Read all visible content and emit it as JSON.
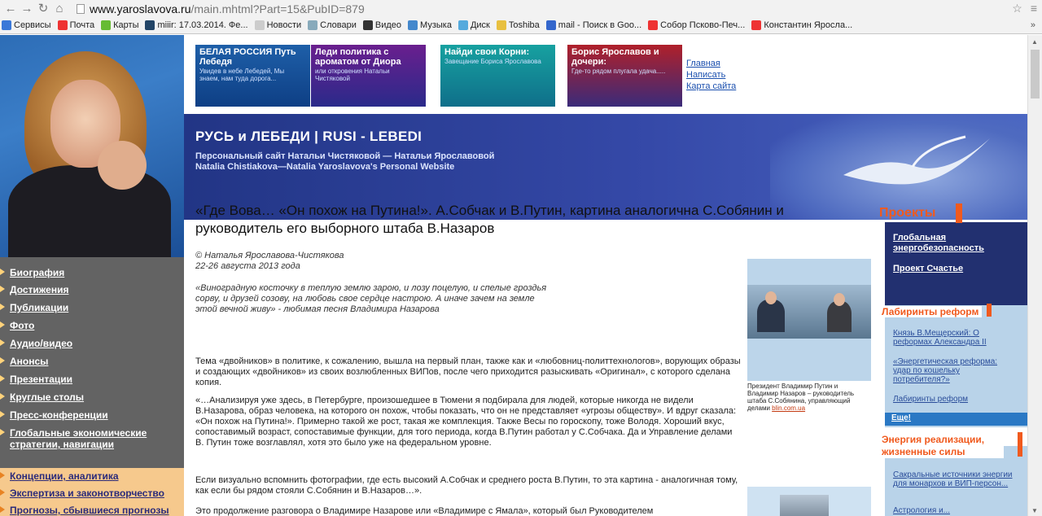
{
  "browser": {
    "url_host": "www.yaroslavova.ru",
    "url_path": "/main.mhtml?Part=15&PubID=879",
    "bookmarks": [
      "Сервисы",
      "Почта",
      "Карты",
      "miiir: 17.03.2014. Фе...",
      "Новости",
      "Словари",
      "Видео",
      "Музыка",
      "Диск",
      "Toshiba",
      "mail - Поиск в Goo...",
      "Собор Псково-Печ...",
      "Константин Яросла..."
    ],
    "more": "»"
  },
  "banners": [
    {
      "title": "БЕЛАЯ РОССИЯ Путь Лебедя",
      "sub": "Увидев в небе Лебедей, Мы знаем, нам туда дорога..."
    },
    {
      "title": "Леди политика с ароматом от Диора",
      "sub": "или откровения Натальи Чистяковой"
    },
    {
      "title": "Найди свои Корни:",
      "sub": "Завещание Бориса Ярославова"
    },
    {
      "title": "Борис Ярославов и дочери:",
      "sub": "Где-то рядом плугала удача....."
    }
  ],
  "toplinks": [
    "Главная",
    "Написать",
    "Карта сайта"
  ],
  "hero": {
    "title": "РУСЬ и ЛЕБЕДИ | RUSI - LEBEDI",
    "sub1": "Персональный сайт Натальи Чистяковой — Натальи Ярославовой",
    "sub2": "Natalia Chistiakova—Natalia Yaroslavova's  Personal Website"
  },
  "leftnav": [
    "Биография",
    "Достижения",
    "Публикации",
    "Фото",
    "Аудио/видео",
    "Анонсы",
    "Презентации",
    "Круглые столы",
    "Пресс-конференции",
    "Глобальные экономические стратегии, навигации",
    "Концепции, аналитика",
    "Экспертиза и законотворчество",
    "Прогнозы, сбывшиеся прогнозы"
  ],
  "article": {
    "title": "«Где Вова… «Он похож на Путина!». А.Собчак и В.Путин, картина аналогична С.Собянин и руководитель его выборного штаба В.Назаров",
    "author": "© Наталья Ярославова-Чистякова",
    "date": "22-26 августа 2013 года",
    "poem": "«Виноградную косточку в теплую землю зарою, и лозу поцелую, и спелые гроздья сорву, и друзей созову, на любовь свое сердце настрою. А иначе зачем на земле этой вечной живу» - любимая песня Владимира Назарова",
    "p1": "Тема «двойников» в политике, к сожалению, вышла на первый план, также как и «любовниц-политтехнологов», ворующих образы и создающих «двойников» из своих возлюбленных ВИПов, после чего приходится разыскивать «Оригинал», с которого сделана копия.",
    "p2": "«…Анализируя уже здесь, в Петербурге, произошедшее в Тюмени я подбирала для людей, которые никогда не видели В.Назарова, образ человека, на которого он похож, чтобы показать, что он не представляет «угрозы обществу». И вдруг сказала: «Он похож на Путина!». Примерно такой же рост, такая же комплекция. Также Весы по гороскопу, тоже Володя. Хороший вкус, сопоставимый возраст, сопоставимые функции, для того периода, когда В.Путин работал у С.Собчака. Да и Управление делами В. Путин тоже возглавлял, хотя это было уже на федеральном уровне.",
    "p3": "Если визуально вспомнить фотографии, где есть высокий А.Собчак и среднего роста В.Путин, то эта картина - аналогичная тому, как если бы рядом стояли С.Собянин и В.Назаров…».",
    "p4": "Это продолжение разговора о Владимире Назарове или «Владимире с Ямала», который был Руководителем",
    "caption": "Президент Владимир Путин и Владимир Назаров – руководитель штаба С.Собянина, управляющий делами",
    "caption_link": "blin.com.ua"
  },
  "right": {
    "projects_title": "Проекты",
    "projects": [
      "Глобальная энергобезопасность",
      "Проект Счастье"
    ],
    "reforms_title": "Лабиринты реформ",
    "reforms": [
      "Князь В.Мещерский: О реформах Александра II",
      "«Энергетическая реформа: удар по кошельку потребителя?»",
      "Лабиринты реформ"
    ],
    "more": "Еще!",
    "energy_title": "Энергия реализации, жизненные силы",
    "energy": [
      "Сакральные источники энергии для монархов и ВИП-персон...",
      "Астрология и..."
    ]
  }
}
